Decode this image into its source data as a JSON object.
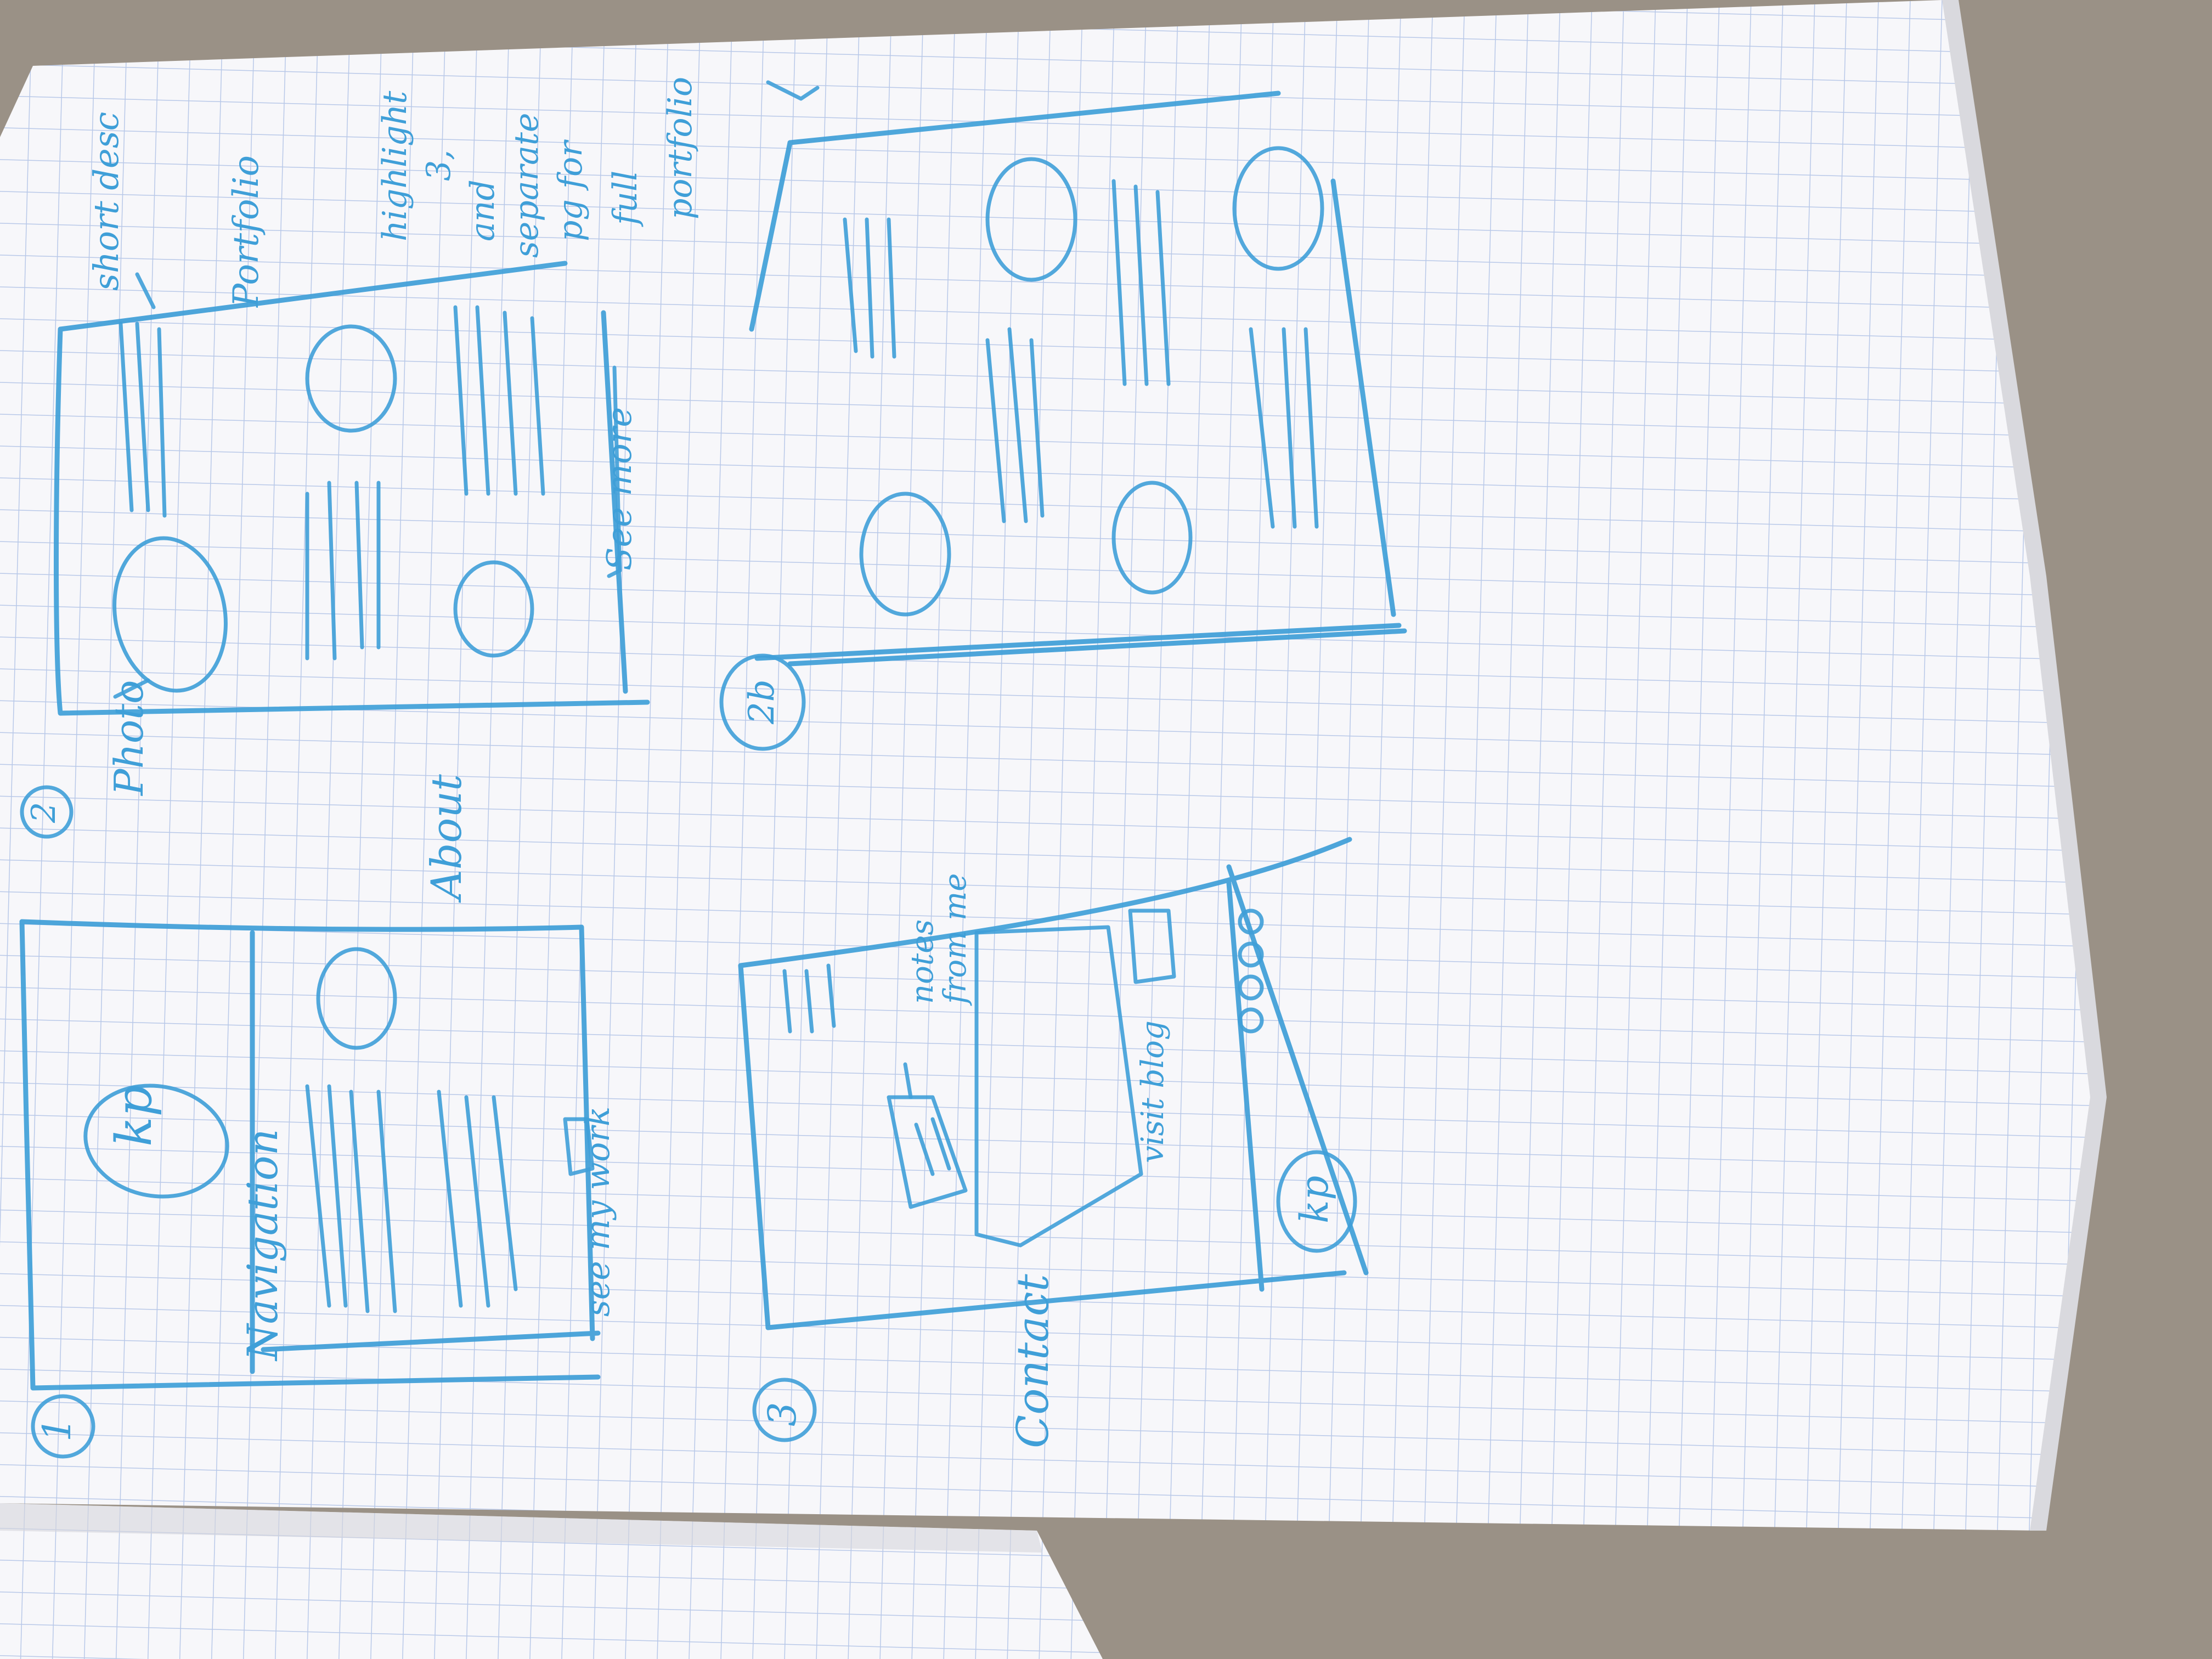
{
  "notebook": {
    "paper_color": "#f7f7fa",
    "grid_color": "#b8c8e8",
    "ink_color": "#3f9fd8",
    "background_color": "#9a9186"
  },
  "sketches": {
    "sketch1": {
      "number": "1",
      "logo_text": "kp",
      "nav_label": "Navigation",
      "section_label": "About",
      "cta_label": "see my work"
    },
    "sketch2": {
      "number": "2",
      "photo_label": "Photo",
      "desc_label": "short desc",
      "section_label": "Portfolio",
      "see_more_label": "See more",
      "note_lines": [
        "highlight",
        "3,",
        "and",
        "separate",
        "pg for",
        "full",
        "portfolio"
      ]
    },
    "sketch2b": {
      "number": "2b"
    },
    "sketch3": {
      "number": "3",
      "section_label": "Contact",
      "notes_label_line1": "notes",
      "notes_label_line2": "from me",
      "blog_label": "visit blog",
      "logo_text": "kp"
    }
  }
}
